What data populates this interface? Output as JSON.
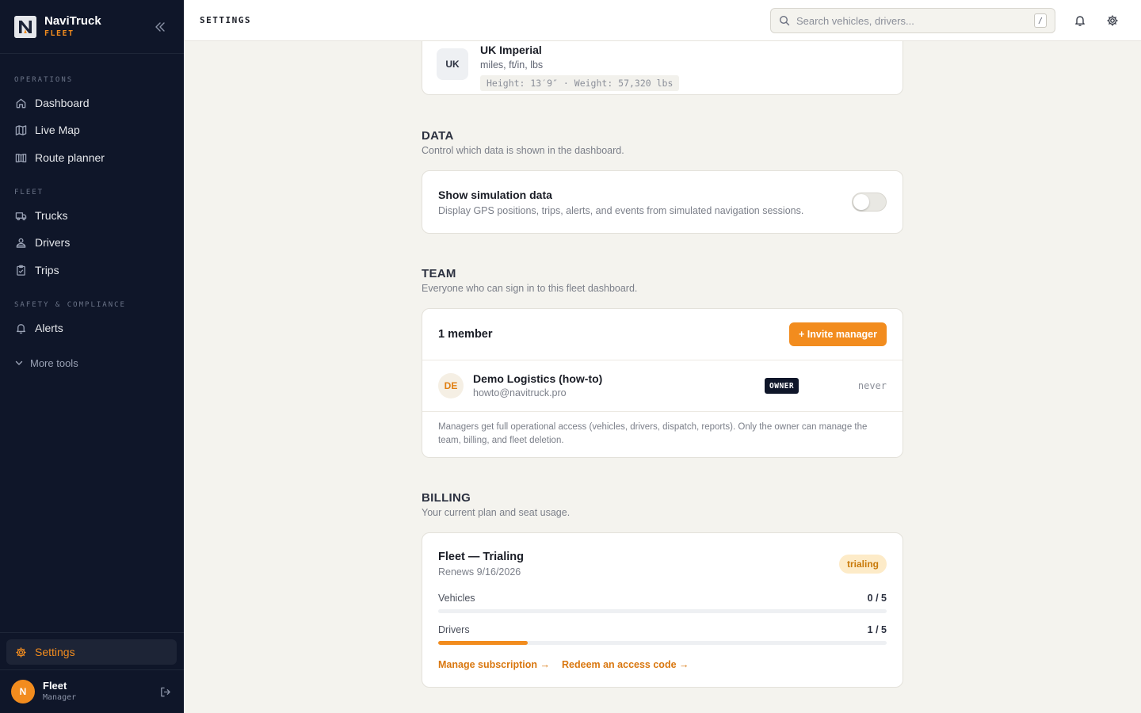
{
  "brand": {
    "name": "NaviTruck",
    "sub": "FLEET"
  },
  "sidebar": {
    "sections": [
      {
        "label": "OPERATIONS"
      },
      {
        "label": "FLEET"
      },
      {
        "label": "SAFETY & COMPLIANCE"
      }
    ],
    "items": [
      {
        "label": "Dashboard",
        "icon": "home-icon"
      },
      {
        "label": "Live Map",
        "icon": "map-icon"
      },
      {
        "label": "Route planner",
        "icon": "route-icon"
      },
      {
        "label": "Trucks",
        "icon": "truck-icon"
      },
      {
        "label": "Drivers",
        "icon": "driver-icon"
      },
      {
        "label": "Trips",
        "icon": "clipboard-icon"
      },
      {
        "label": "Alerts",
        "icon": "bell-icon"
      }
    ],
    "more_tools": "More tools",
    "settings": "Settings"
  },
  "user": {
    "initial": "N",
    "name": "Fleet",
    "role": "Manager"
  },
  "topbar": {
    "title": "SETTINGS",
    "search_placeholder": "Search vehicles, drivers...",
    "search_shortcut": "/"
  },
  "units": {
    "badge": "UK",
    "name": "UK Imperial",
    "desc": "miles, ft/in, lbs",
    "example": "Height: 13′9″ · Weight: 57,320 lbs"
  },
  "data_section": {
    "title": "DATA",
    "subtitle": "Control which data is shown in the dashboard.",
    "toggle_title": "Show simulation data",
    "toggle_desc": "Display GPS positions, trips, alerts, and events from simulated navigation sessions.",
    "toggle_on": false
  },
  "team": {
    "title": "TEAM",
    "subtitle": "Everyone who can sign in to this fleet dashboard.",
    "count_label": "1 member",
    "invite_label": "+ Invite manager",
    "members": [
      {
        "initials": "DE",
        "name": "Demo Logistics (how-to)",
        "email": "howto@navitruck.pro",
        "role": "OWNER",
        "last_seen": "never"
      }
    ],
    "note": "Managers get full operational access (vehicles, drivers, dispatch, reports). Only the owner can manage the team, billing, and fleet deletion."
  },
  "billing": {
    "title": "BILLING",
    "subtitle": "Your current plan and seat usage.",
    "plan": "Fleet — Trialing",
    "renews": "Renews 9/16/2026",
    "status": "trialing",
    "usage": [
      {
        "label": "Vehicles",
        "count": "0 / 5",
        "fraction": 0
      },
      {
        "label": "Drivers",
        "count": "1 / 5",
        "fraction": 0.2
      }
    ],
    "manage_link": "Manage subscription →",
    "redeem_link": "Redeem an access code →"
  },
  "colors": {
    "accent": "#f28c1e",
    "sidebar_bg": "#0f1629",
    "page_bg": "#f4f3ee"
  }
}
